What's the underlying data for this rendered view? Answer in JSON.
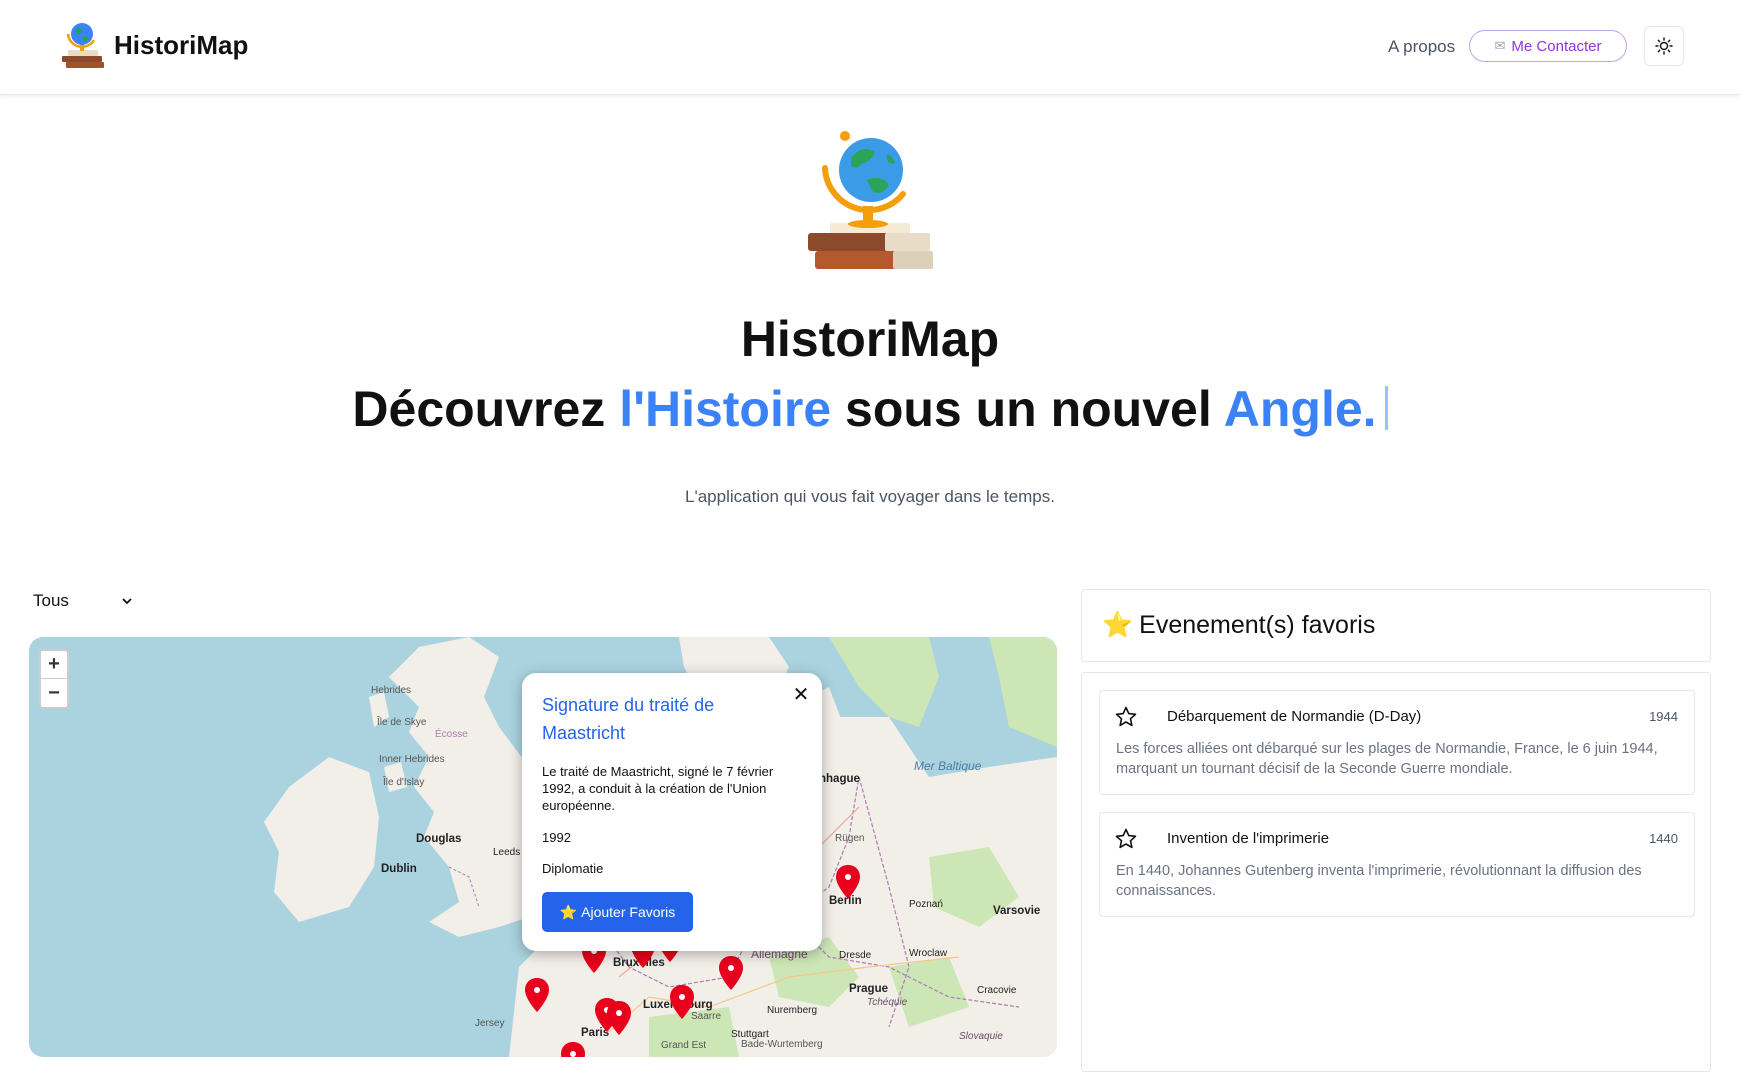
{
  "header": {
    "brand": "HistoriMap",
    "about_label": "A propos",
    "contact_label": "Me Contacter"
  },
  "hero": {
    "title": "HistoriMap",
    "tagline_part1": "Découvrez ",
    "tagline_highlight1": "l'Histoire",
    "tagline_part2": " sous un nouvel ",
    "tagline_highlight2": "Angle.",
    "subtitle": "L'application qui vous fait voyager dans le temps."
  },
  "filter": {
    "selected": "Tous"
  },
  "map": {
    "labels": {
      "douglas": "Douglas",
      "dublin": "Dublin",
      "leeds": "Leeds",
      "bruxelles": "Bruxelles",
      "luxembourg": "Luxembourg",
      "paris": "Paris",
      "berlin": "Berlin",
      "poznan": "Poznań",
      "varsovie": "Varsovie",
      "prague": "Prague",
      "dresde": "Dresde",
      "wroclaw": "Wroclaw",
      "cracovie": "Cracovie",
      "nuremberg": "Nuremberg",
      "stuttgart": "Stuttgart",
      "copenhague": "nhague",
      "mer_baltique": "Mer Baltique",
      "rugen": "Rügen",
      "allemagne": "Allemagne",
      "tchequie": "Tchéquie",
      "slovaquie": "Slovaquie",
      "hebrides": "Hebrides",
      "ile_de_skye": "Île de Skye",
      "ecosse": "Écosse",
      "inner_hebrides": "Inner Hebrides",
      "ile_d_islay": "Île d'Islay",
      "jersey": "Jersey",
      "saarland": "Saarre",
      "baden": "Bade-Wurtemberg",
      "grand_est": "Grand Est"
    }
  },
  "popup": {
    "title": "Signature du traité de Maastricht",
    "description": "Le traité de Maastricht, signé le 7 février 1992, a conduit à la création de l'Union européenne.",
    "year": "1992",
    "category": "Diplomatie",
    "button_emoji": "⭐",
    "button_label": "Ajouter Favoris"
  },
  "favorites": {
    "header_emoji": "⭐",
    "header_label": "Evenement(s) favoris",
    "items": [
      {
        "title": "Débarquement de Normandie (D-Day)",
        "year": "1944",
        "description": "Les forces alliées ont débarqué sur les plages de Normandie, France, le 6 juin 1944, marquant un tournant décisif de la Seconde Guerre mondiale."
      },
      {
        "title": "Invention de l'imprimerie",
        "year": "1440",
        "description": "En 1440, Johannes Gutenberg inventa l'imprimerie, révolutionnant la diffusion des connaissances."
      }
    ]
  },
  "colors": {
    "accent_blue": "#3b82f6",
    "button_blue": "#2563eb",
    "contact_purple": "#9333ea",
    "marker_red": "#e8001c",
    "sea": "#aad3df",
    "land": "#f2efe9"
  }
}
